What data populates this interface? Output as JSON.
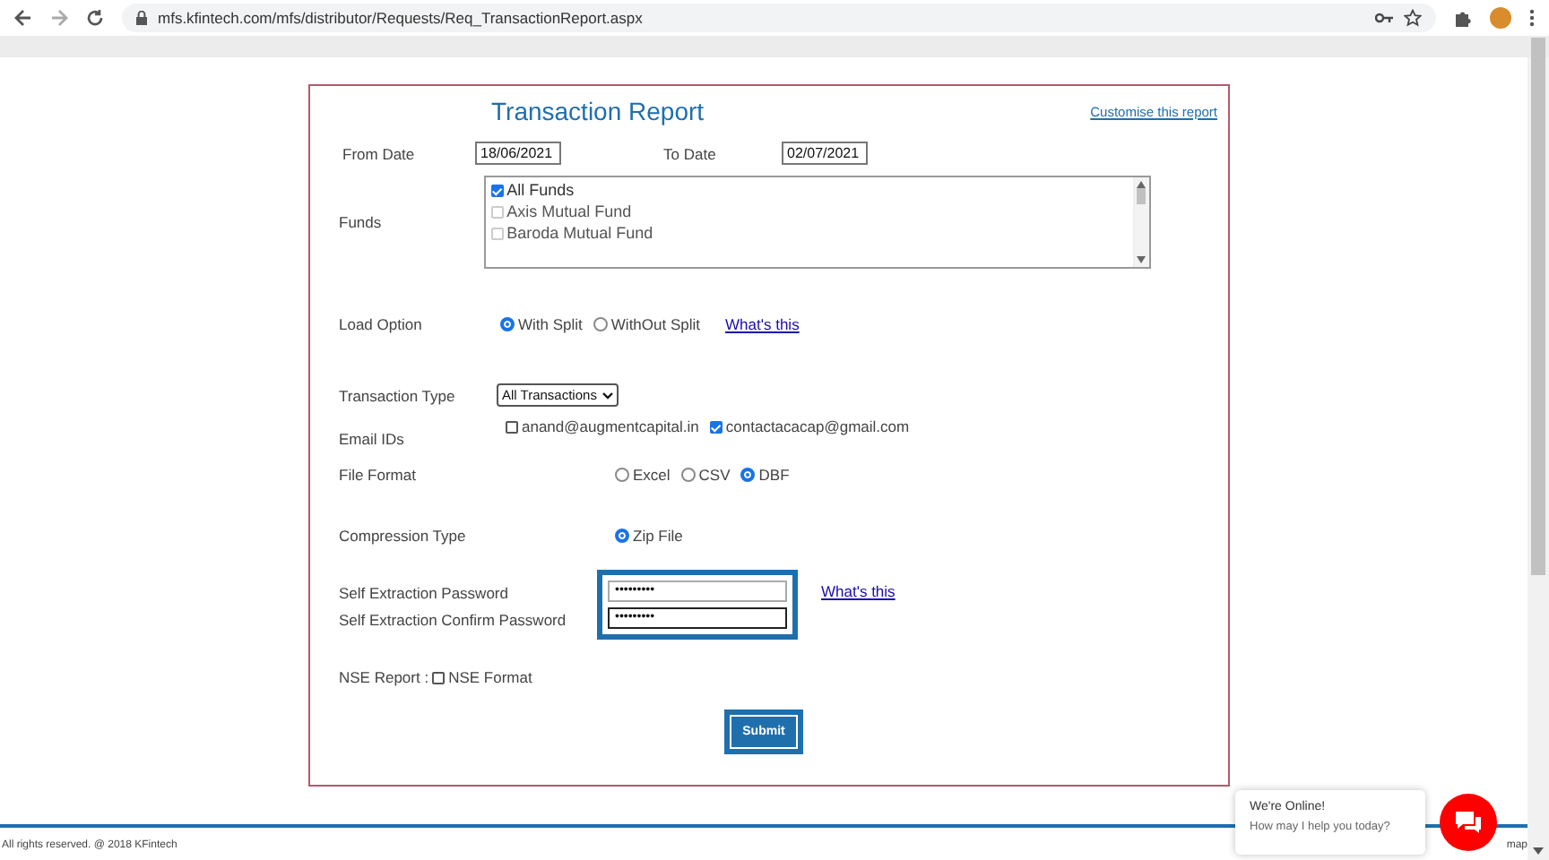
{
  "browser": {
    "url": "mfs.kfintech.com/mfs/distributor/Requests/Req_TransactionReport.aspx"
  },
  "form": {
    "title": "Transaction Report",
    "customise_link": "Customise this report",
    "from_date": {
      "label": "From Date",
      "value": "18/06/2021"
    },
    "to_date": {
      "label": "To Date",
      "value": "02/07/2021"
    },
    "funds": {
      "label": "Funds",
      "items": [
        {
          "label": "All Funds",
          "checked": true,
          "disabled": false
        },
        {
          "label": "Axis Mutual Fund",
          "checked": false,
          "disabled": true
        },
        {
          "label": "Baroda Mutual Fund",
          "checked": false,
          "disabled": true
        }
      ]
    },
    "load_option": {
      "label": "Load Option",
      "options": [
        {
          "label": "With Split",
          "selected": true
        },
        {
          "label": "WithOut Split",
          "selected": false
        }
      ],
      "link": "What's this"
    },
    "transaction_type": {
      "label": "Transaction Type",
      "value": "All Transactions"
    },
    "email_ids": {
      "label": "Email IDs",
      "items": [
        {
          "label": "anand@augmentcapital.in",
          "checked": false
        },
        {
          "label": "contactacacap@gmail.com",
          "checked": true
        }
      ]
    },
    "file_format": {
      "label": "File Format",
      "options": [
        {
          "label": "Excel",
          "selected": false
        },
        {
          "label": "CSV",
          "selected": false
        },
        {
          "label": "DBF",
          "selected": true
        }
      ]
    },
    "compression_type": {
      "label": "Compression Type",
      "options": [
        {
          "label": "Zip File",
          "selected": true
        }
      ]
    },
    "password": {
      "label": "Self Extraction Password",
      "value": "•••••••••"
    },
    "confirm_password": {
      "label": "Self Extraction Confirm Password",
      "value": "•••••••••"
    },
    "password_link": "What's this",
    "nse_report": {
      "label": "NSE Report :",
      "option": {
        "label": "NSE Format",
        "checked": false
      }
    },
    "submit": "Submit"
  },
  "footer": {
    "copyright": "All rights reserved. @ 2018 KFintech",
    "tail": "map"
  },
  "chat": {
    "title": "We're Online!",
    "subtitle": "How may I help you today?"
  }
}
